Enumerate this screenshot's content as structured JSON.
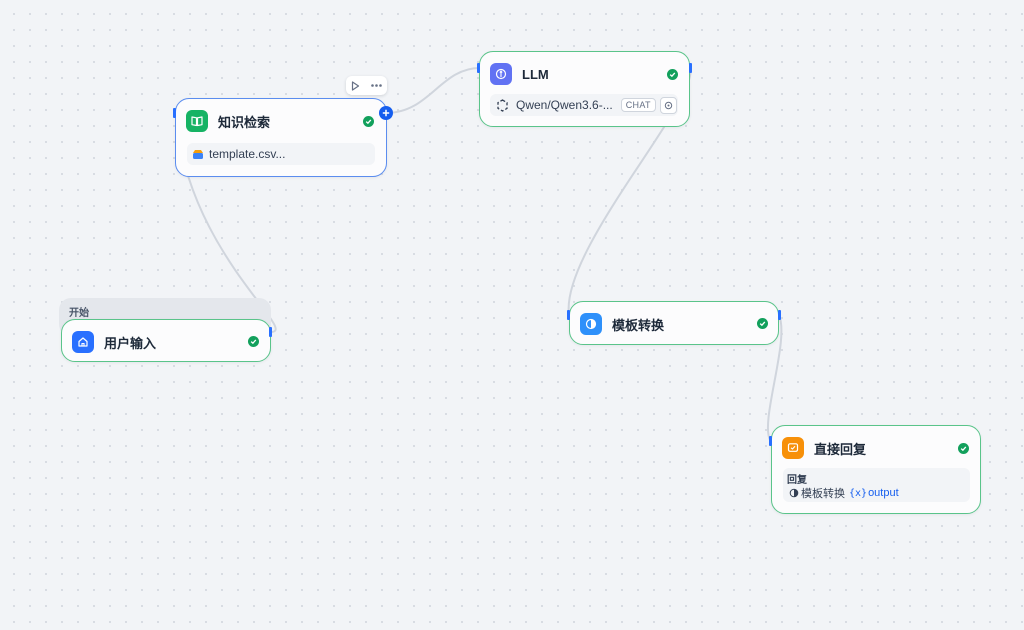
{
  "colors": {
    "canvas_bg": "#f2f4f7",
    "edge": "#d0d5dd",
    "success_border": "#5ac48a",
    "selected_border": "#5b8def",
    "handle": "#2970ff",
    "check": "#12a05c"
  },
  "nodes": {
    "knowledge": {
      "title": "知识检索",
      "icon": "book-icon",
      "icon_color": "#16b364",
      "dataset": "template.csv...",
      "status": "success",
      "selected": true,
      "toolbar": {
        "run_icon": "play-icon",
        "more_icon": "more-icon"
      }
    },
    "llm": {
      "title": "LLM",
      "icon": "llm-icon",
      "icon_color": "#6172f3",
      "model": "Qwen/Qwen3.6-...",
      "mode_tag": "CHAT",
      "status": "success"
    },
    "start": {
      "group_label": "开始",
      "title": "用户输入",
      "icon": "home-icon",
      "icon_color": "#2970ff",
      "status": "success"
    },
    "template": {
      "title": "模板转换",
      "icon": "template-icon",
      "icon_color": "#2e90fa",
      "status": "success"
    },
    "answer": {
      "title": "直接回复",
      "icon": "reply-icon",
      "icon_color": "#f79009",
      "field_label": "回复",
      "var_source": "模板转换",
      "var_name": "output",
      "status": "success"
    }
  }
}
